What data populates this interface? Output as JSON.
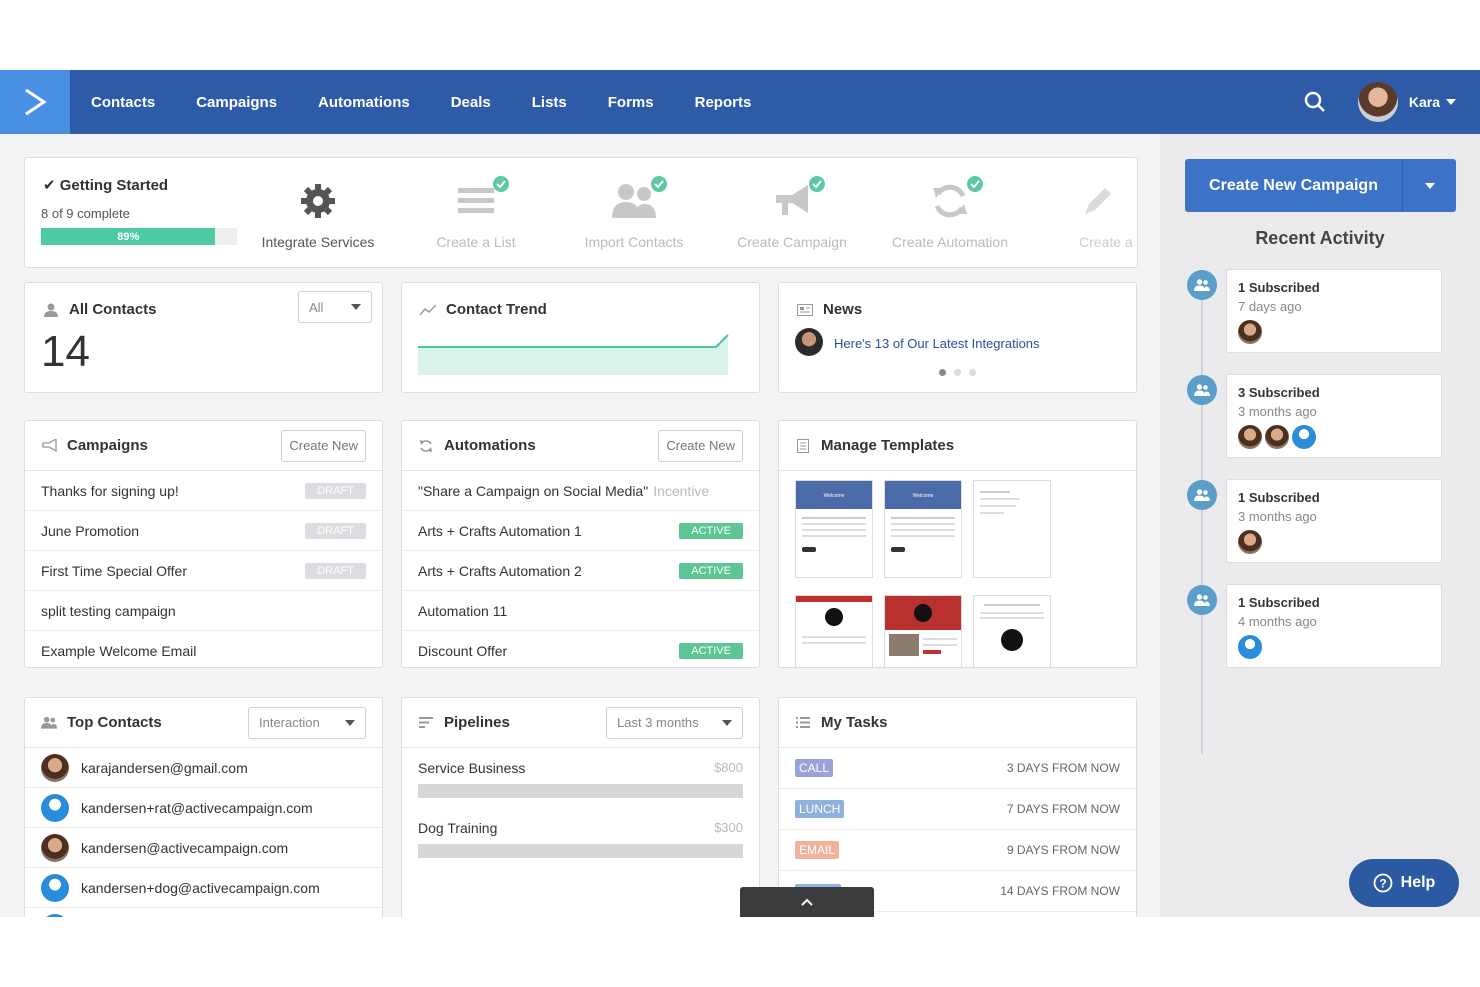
{
  "nav": {
    "items": [
      "Contacts",
      "Campaigns",
      "Automations",
      "Deals",
      "Lists",
      "Forms",
      "Reports"
    ],
    "user_name": "Kara"
  },
  "getting_started": {
    "title": "Getting Started",
    "progress_text": "8 of 9 complete",
    "progress_percent": 89,
    "progress_label": "89%",
    "steps": [
      {
        "label": "Integrate Services",
        "done": false
      },
      {
        "label": "Create a List",
        "done": true
      },
      {
        "label": "Import Contacts",
        "done": true
      },
      {
        "label": "Create Campaign",
        "done": true
      },
      {
        "label": "Create Automation",
        "done": true
      },
      {
        "label": "Create a I",
        "done": false
      }
    ]
  },
  "all_contacts": {
    "title": "All Contacts",
    "filter": "All",
    "count": "14"
  },
  "contact_trend": {
    "title": "Contact Trend"
  },
  "news": {
    "title": "News",
    "headline": "Here's 13 of Our Latest Integrations"
  },
  "campaigns": {
    "title": "Campaigns",
    "create_label": "Create New",
    "rows": [
      {
        "name": "Thanks for signing up!",
        "status": "DRAFT"
      },
      {
        "name": "June Promotion",
        "status": "DRAFT"
      },
      {
        "name": "First Time Special Offer",
        "status": "DRAFT"
      },
      {
        "name": "split testing campaign",
        "status": ""
      },
      {
        "name": "Example Welcome Email",
        "status": ""
      }
    ]
  },
  "automations": {
    "title": "Automations",
    "create_label": "Create New",
    "rows": [
      {
        "name": "\"Share a Campaign on Social Media\"",
        "extra": "Incentive",
        "status": ""
      },
      {
        "name": "Arts + Crafts Automation 1",
        "extra": "",
        "status": "ACTIVE"
      },
      {
        "name": "Arts + Crafts Automation 2",
        "extra": "",
        "status": "ACTIVE"
      },
      {
        "name": "Automation 11",
        "extra": "",
        "status": ""
      },
      {
        "name": "Discount Offer",
        "extra": "",
        "status": "ACTIVE"
      }
    ]
  },
  "templates": {
    "title": "Manage Templates",
    "thumb_heading": "Welcome"
  },
  "top_contacts": {
    "title": "Top Contacts",
    "filter": "Interaction",
    "rows": [
      {
        "email": "karajandersen@gmail.com",
        "avatar": "photo"
      },
      {
        "email": "kandersen+rat@activecampaign.com",
        "avatar": "default"
      },
      {
        "email": "kandersen@activecampaign.com",
        "avatar": "photo"
      },
      {
        "email": "kandersen+dog@activecampaign.com",
        "avatar": "default"
      }
    ]
  },
  "pipelines": {
    "title": "Pipelines",
    "filter": "Last 3 months",
    "rows": [
      {
        "name": "Service Business",
        "value": "$800"
      },
      {
        "name": "Dog Training",
        "value": "$300"
      }
    ]
  },
  "tasks": {
    "title": "My Tasks",
    "rows": [
      {
        "type": "CALL",
        "color": "#9aa3d9",
        "due": "3 DAYS FROM NOW"
      },
      {
        "type": "LUNCH",
        "color": "#8fb2dd",
        "due": "7 DAYS FROM NOW"
      },
      {
        "type": "EMAIL",
        "color": "#f0b39c",
        "due": "9 DAYS FROM NOW"
      },
      {
        "type": "",
        "color": "#8fb2dd",
        "due": "14 DAYS FROM NOW"
      }
    ]
  },
  "sidebar": {
    "cta_label": "Create New Campaign",
    "recent_title": "Recent Activity",
    "activities": [
      {
        "title": "1 Subscribed",
        "time": "7 days ago",
        "avatars": [
          "photo"
        ]
      },
      {
        "title": "3 Subscribed",
        "time": "3 months ago",
        "avatars": [
          "photo",
          "photo",
          "default"
        ]
      },
      {
        "title": "1 Subscribed",
        "time": "3 months ago",
        "avatars": [
          "photo"
        ]
      },
      {
        "title": "1 Subscribed",
        "time": "4 months ago",
        "avatars": [
          "default"
        ]
      }
    ],
    "help_label": "Help"
  },
  "colors": {
    "nav": "#2c5ba7",
    "accent": "#3d73c6",
    "active": "#5cc795",
    "progress": "#4ec9a6"
  }
}
